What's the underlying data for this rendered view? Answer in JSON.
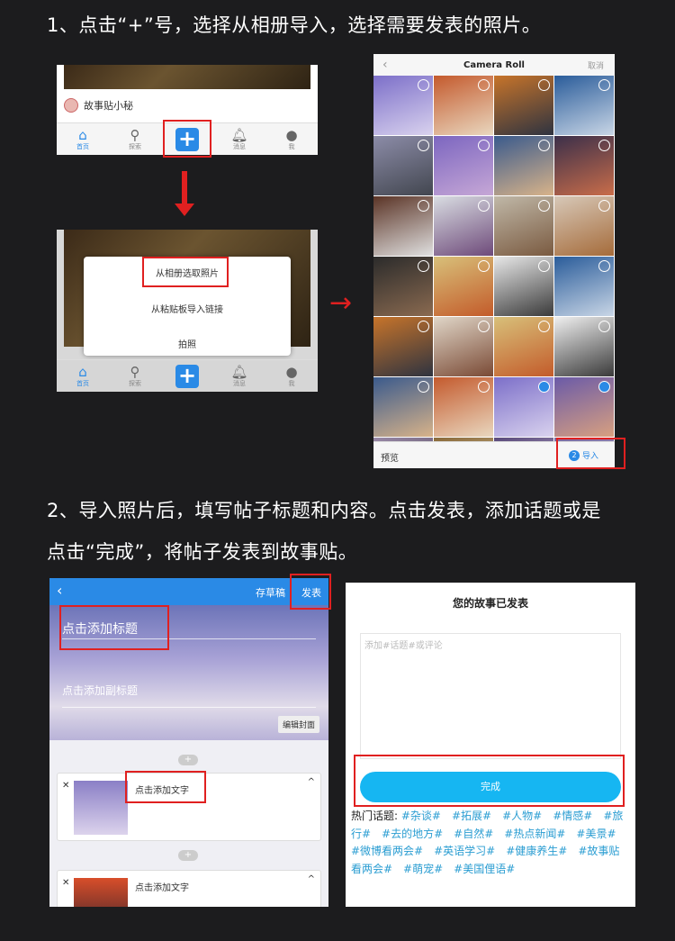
{
  "step1": {
    "heading": "1、点击“+”号，选择从相册导入，选择需要发表的照片。",
    "feed": {
      "username": "故事贴小秘"
    },
    "tabs": [
      "首页",
      "探索",
      "消息",
      "我"
    ],
    "modal": {
      "from_album": "从相册选取照片",
      "from_clipboard": "从粘贴板导入链接",
      "take_photo": "拍照"
    },
    "camera_roll": {
      "title": "Camera Roll",
      "cancel": "取消",
      "preview": "预览",
      "import_count": "2",
      "import_label": "导入"
    }
  },
  "step2": {
    "heading_line1": "2、导入照片后，填写帖子标题和内容。点击发表，添加话题或是",
    "heading_line2": "点击“完成”，将帖子发表到故事贴。",
    "editor": {
      "save_draft": "存草稿",
      "publish": "发表",
      "title_placeholder": "点击添加标题",
      "subtitle_placeholder": "点击添加副标题",
      "edit_cover": "编辑封面",
      "add_text": "点击添加文字",
      "add_text_2": "点击添加文字"
    },
    "published": {
      "title": "您的故事已发表",
      "placeholder": "添加#话题#或评论",
      "done_button": "完成",
      "hot_label": "热门话题:",
      "hot_tags": "#杂谈#　#拓展#　#人物#　#情感#　#旅行#　#去的地方#　#自然#　#热点新闻#　#美景#　#微博看两会#　#英语学习#　#健康养生#　#故事贴看两会#　#萌宠#　#美国俚语#"
    }
  },
  "colors": {
    "background": "#1c1c1e",
    "highlight_red": "#e02020",
    "app_blue": "#2a8ae6",
    "done_button": "#16b6f2"
  }
}
